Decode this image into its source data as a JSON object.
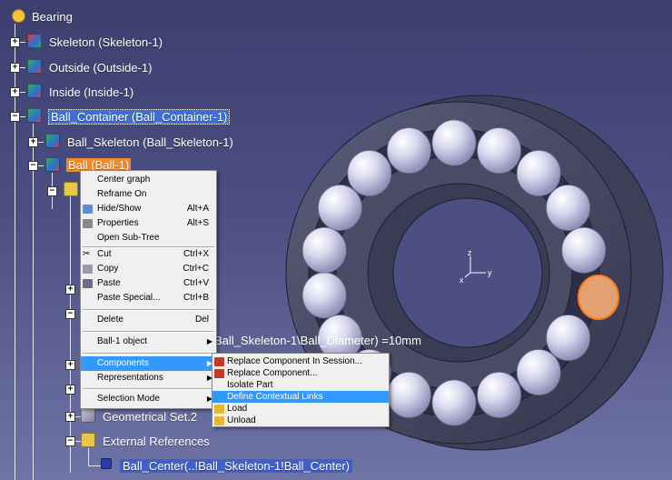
{
  "tree": {
    "root": "Bearing",
    "nodes": [
      {
        "label": "Skeleton (Skeleton-1)"
      },
      {
        "label": "Outside (Outside-1)"
      },
      {
        "label": "Inside (Inside-1)"
      },
      {
        "label": "Ball_Container (Ball_Container-1)"
      },
      {
        "label": "Ball_Skeleton (Ball_Skeleton-1)"
      },
      {
        "label": "Ball (Ball-1)"
      },
      {
        "label": "Geometrical Set.2"
      },
      {
        "label": "External References"
      },
      {
        "label": "Ball_Center(..!Ball_Skeleton-1!Ball_Center)"
      }
    ]
  },
  "parameter_readout": "Ball_Skeleton-1\\Ball_Diameter) =10mm",
  "context_menu": {
    "items": [
      {
        "label": "Center graph",
        "shortcut": ""
      },
      {
        "label": "Reframe On",
        "shortcut": ""
      },
      {
        "label": "Hide/Show",
        "shortcut": "Alt+A"
      },
      {
        "label": "Properties",
        "shortcut": "Alt+S"
      },
      {
        "label": "Open Sub-Tree",
        "shortcut": ""
      },
      {
        "label": "Cut",
        "shortcut": "Ctrl+X"
      },
      {
        "label": "Copy",
        "shortcut": "Ctrl+C"
      },
      {
        "label": "Paste",
        "shortcut": "Ctrl+V"
      },
      {
        "label": "Paste Special...",
        "shortcut": "Ctrl+B"
      },
      {
        "label": "Delete",
        "shortcut": "Del"
      },
      {
        "label": "Ball-1 object",
        "shortcut": ""
      },
      {
        "label": "Components",
        "shortcut": ""
      },
      {
        "label": "Representations",
        "shortcut": ""
      },
      {
        "label": "Selection Mode",
        "shortcut": ""
      }
    ]
  },
  "submenu": {
    "items": [
      {
        "label": "Replace Component In Session..."
      },
      {
        "label": "Replace Component..."
      },
      {
        "label": "Isolate Part"
      },
      {
        "label": "Define Contextual Links"
      },
      {
        "label": "Load"
      },
      {
        "label": "Unload"
      }
    ]
  },
  "compass": {
    "z": "z",
    "y": "y",
    "x": "x"
  },
  "colors": {
    "selection_blue": "#3e6fd6",
    "selection_orange": "#f08a2a",
    "menu_highlight": "#3399ff"
  }
}
